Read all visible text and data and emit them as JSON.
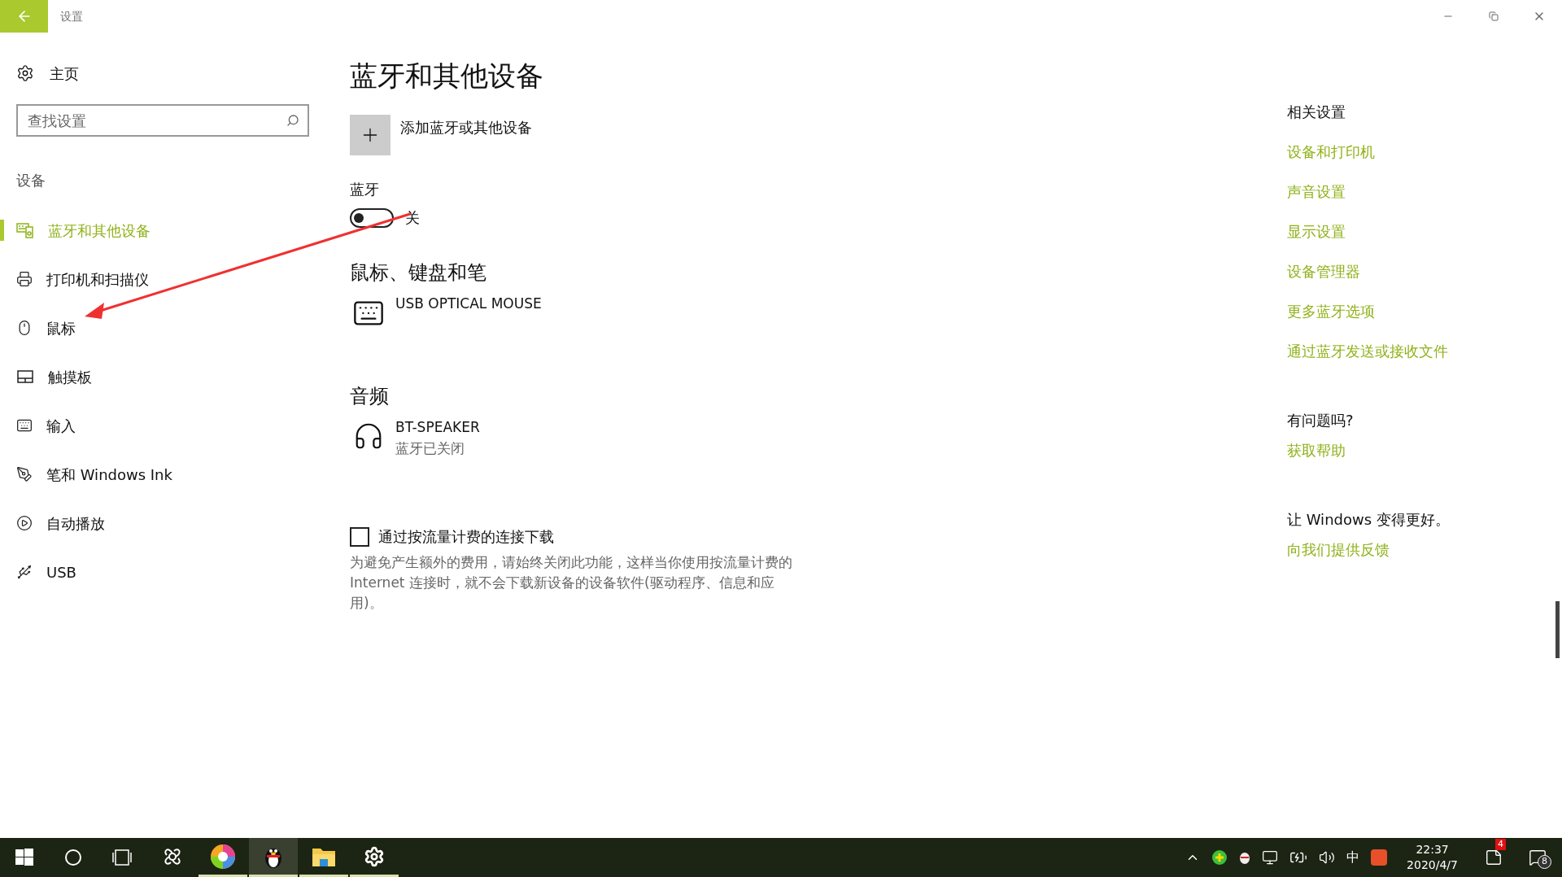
{
  "window": {
    "title": "设置"
  },
  "sidebar": {
    "home": "主页",
    "search": {
      "placeholder": "查找设置"
    },
    "section": "设备",
    "items": [
      {
        "label": "蓝牙和其他设备",
        "selected": true
      },
      {
        "label": "打印机和扫描仪",
        "selected": false
      },
      {
        "label": "鼠标",
        "selected": false
      },
      {
        "label": "触摸板",
        "selected": false
      },
      {
        "label": "输入",
        "selected": false
      },
      {
        "label": "笔和 Windows Ink",
        "selected": false
      },
      {
        "label": "自动播放",
        "selected": false
      },
      {
        "label": "USB",
        "selected": false
      }
    ]
  },
  "main": {
    "title": "蓝牙和其他设备",
    "add_device": "添加蓝牙或其他设备",
    "bluetooth": {
      "label": "蓝牙",
      "on": false,
      "state_text": "关"
    },
    "groups": [
      {
        "heading": "鼠标、键盘和笔",
        "devices": [
          {
            "kind": "keyboard",
            "name": "USB OPTICAL MOUSE"
          }
        ]
      },
      {
        "heading": "音频",
        "devices": [
          {
            "kind": "headset",
            "name": "BT-SPEAKER",
            "status": "蓝牙已关闭"
          }
        ]
      }
    ],
    "metered": {
      "label": "通过按流量计费的连接下载",
      "checked": false,
      "description": "为避免产生额外的费用，请始终关闭此功能，这样当你使用按流量计费的 Internet 连接时，就不会下载新设备的设备软件(驱动程序、信息和应用)。"
    }
  },
  "related": {
    "heading": "相关设置",
    "links": [
      "设备和打印机",
      "声音设置",
      "显示设置",
      "设备管理器",
      "更多蓝牙选项",
      "通过蓝牙发送或接收文件"
    ]
  },
  "help": {
    "heading": "有问题吗?",
    "link": "获取帮助"
  },
  "feedback": {
    "heading": "让 Windows 变得更好。",
    "link": "向我们提供反馈"
  },
  "taskbar": {
    "apps": [
      {
        "kind": "pinwheel",
        "running": false,
        "selected": false
      },
      {
        "kind": "colorwheel",
        "running": true,
        "selected": false
      },
      {
        "kind": "penguin",
        "running": true,
        "selected": true
      },
      {
        "kind": "folder",
        "running": true,
        "selected": false
      },
      {
        "kind": "gear",
        "running": true,
        "selected": false
      }
    ],
    "ime": "中",
    "time": "22:37",
    "date": "2020/4/7",
    "notification_badge": "4",
    "action_center_count": "8"
  }
}
